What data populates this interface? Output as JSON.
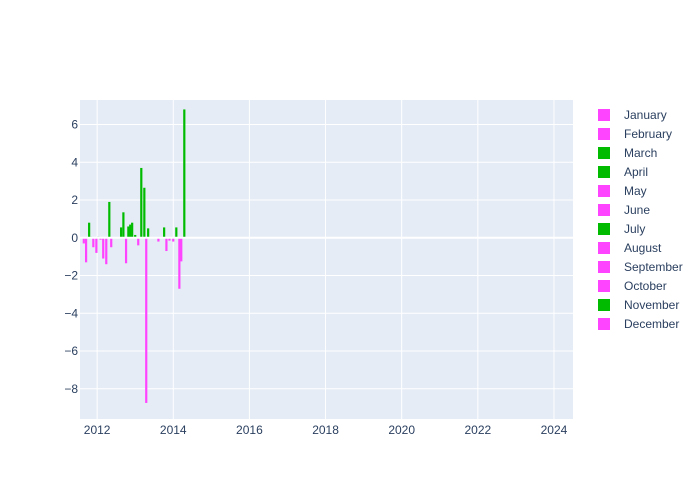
{
  "chart_data": {
    "type": "bar",
    "title": "",
    "xlabel": "",
    "ylabel": "",
    "xlim": [
      2011.55,
      2024.5
    ],
    "ylim": [
      -9.6,
      7.3
    ],
    "grid": true,
    "legend_placement": "right",
    "x_ticks": [
      {
        "value": 2012,
        "label": "2012"
      },
      {
        "value": 2014,
        "label": "2014"
      },
      {
        "value": 2016,
        "label": "2016"
      },
      {
        "value": 2018,
        "label": "2018"
      },
      {
        "value": 2020,
        "label": "2020"
      },
      {
        "value": 2022,
        "label": "2022"
      },
      {
        "value": 2024,
        "label": "2024"
      }
    ],
    "y_ticks": [
      {
        "value": 6,
        "label": "6"
      },
      {
        "value": 4,
        "label": "4"
      },
      {
        "value": 2,
        "label": "2"
      },
      {
        "value": 0,
        "label": "0"
      },
      {
        "value": -2,
        "label": "−2"
      },
      {
        "value": -4,
        "label": "−4"
      },
      {
        "value": -6,
        "label": "−6"
      },
      {
        "value": -8,
        "label": "−8"
      }
    ],
    "colors": {
      "positive": "#00bb00",
      "negative": "#ff44ff"
    },
    "legend": [
      {
        "name": "January",
        "color": "#ff44ff"
      },
      {
        "name": "February",
        "color": "#ff44ff"
      },
      {
        "name": "March",
        "color": "#00bb00"
      },
      {
        "name": "April",
        "color": "#00bb00"
      },
      {
        "name": "May",
        "color": "#ff44ff"
      },
      {
        "name": "June",
        "color": "#ff44ff"
      },
      {
        "name": "July",
        "color": "#00bb00"
      },
      {
        "name": "August",
        "color": "#ff44ff"
      },
      {
        "name": "September",
        "color": "#ff44ff"
      },
      {
        "name": "October",
        "color": "#ff44ff"
      },
      {
        "name": "November",
        "color": "#00bb00"
      },
      {
        "name": "December",
        "color": "#ff44ff"
      }
    ],
    "x": [
      2011.65,
      2011.71,
      2011.79,
      2011.84,
      2011.9,
      2011.98,
      2012.03,
      2012.09,
      2012.16,
      2012.24,
      2012.32,
      2012.37,
      2012.63,
      2012.69,
      2012.76,
      2012.82,
      2012.87,
      2012.92,
      2013.0,
      2013.08,
      2013.16,
      2013.24,
      2013.29,
      2013.34,
      2013.61,
      2013.76,
      2013.82,
      2013.9,
      2014.0,
      2014.08,
      2014.16,
      2014.21,
      2014.29
    ],
    "values": [
      -0.3,
      -1.3,
      0.8,
      0.05,
      -0.5,
      -0.8,
      0.05,
      -0.1,
      -1.1,
      -1.4,
      1.9,
      -0.5,
      0.55,
      1.35,
      -1.35,
      0.6,
      0.7,
      0.8,
      0.15,
      -0.4,
      3.7,
      2.65,
      -8.75,
      0.5,
      -0.2,
      0.55,
      -0.7,
      -0.15,
      -0.2,
      0.55,
      -2.7,
      -1.25,
      6.8
    ]
  }
}
